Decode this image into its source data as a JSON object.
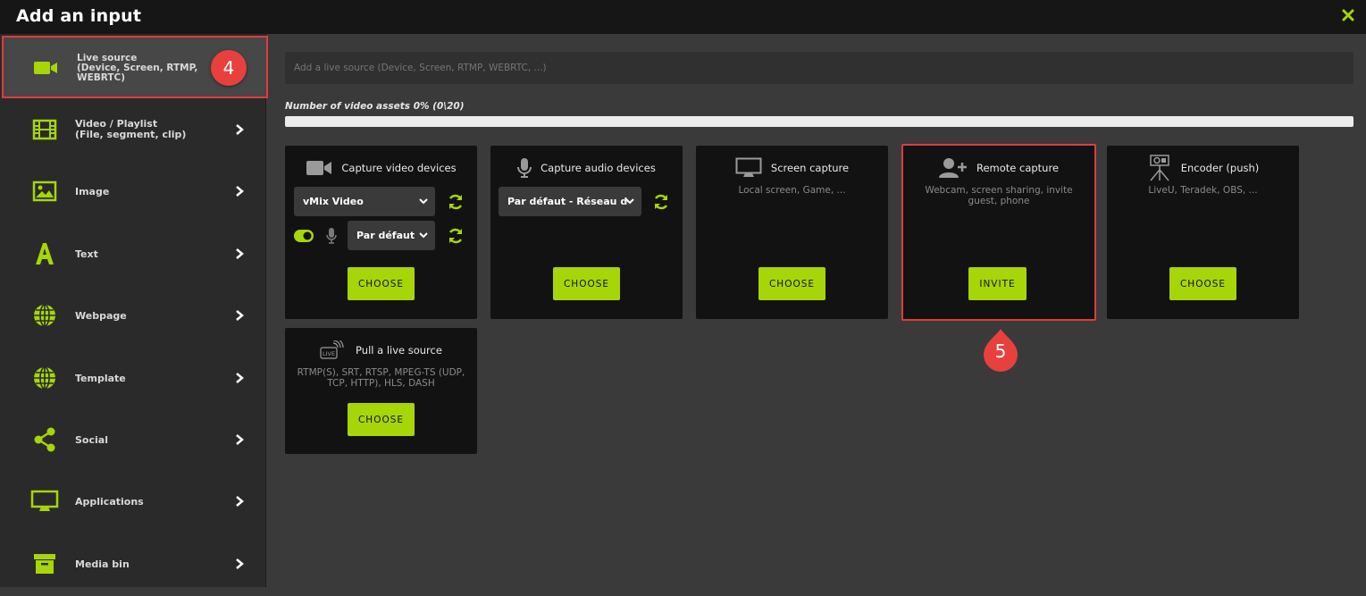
{
  "window": {
    "title": "Add an input"
  },
  "sidebar": {
    "items": [
      {
        "label": "Live source\n(Device, Screen, RTMP,\nWEBRTC)",
        "icon": "video-camera-icon",
        "active": true
      },
      {
        "label": "Video / Playlist\n(File, segment, clip)",
        "icon": "film-icon"
      },
      {
        "label": "Image",
        "icon": "image-icon"
      },
      {
        "label": "Text",
        "icon": "text-icon"
      },
      {
        "label": "Webpage",
        "icon": "globe-icon"
      },
      {
        "label": "Template",
        "icon": "globe-icon"
      },
      {
        "label": "Social",
        "icon": "share-icon"
      },
      {
        "label": "Applications",
        "icon": "monitor-icon"
      },
      {
        "label": "Media bin",
        "icon": "archive-icon"
      }
    ]
  },
  "badges": {
    "step4": "4",
    "step5": "5"
  },
  "main": {
    "search_placeholder": "Add a live source (Device, Screen, RTMP, WEBRTC, ...)",
    "progress_label": "Number of video assets 0% (0\\20)",
    "progress_fraction": 0
  },
  "cards": {
    "video": {
      "title": "Capture video devices",
      "device": "vMix Video",
      "audio": "Par défaut",
      "button": "CHOOSE"
    },
    "audio": {
      "title": "Capture audio devices",
      "device": "Par défaut - Réseau d",
      "button": "CHOOSE"
    },
    "screen": {
      "title": "Screen capture",
      "subtitle": "Local screen, Game, ...",
      "button": "CHOOSE"
    },
    "remote": {
      "title": "Remote capture",
      "subtitle": "Webcam, screen sharing, invite guest, phone",
      "button": "INVITE"
    },
    "encoder": {
      "title": "Encoder (push)",
      "subtitle": "LiveU, Teradek, OBS, ...",
      "button": "CHOOSE"
    },
    "pull": {
      "title": "Pull a live source",
      "subtitle": "RTMP(S), SRT, RTSP, MPEG-TS (UDP, TCP, HTTP), HLS, DASH",
      "button": "CHOOSE"
    }
  },
  "colors": {
    "accent": "#a6d608",
    "highlight": "#e03c3c",
    "badge": "#e8403d"
  }
}
